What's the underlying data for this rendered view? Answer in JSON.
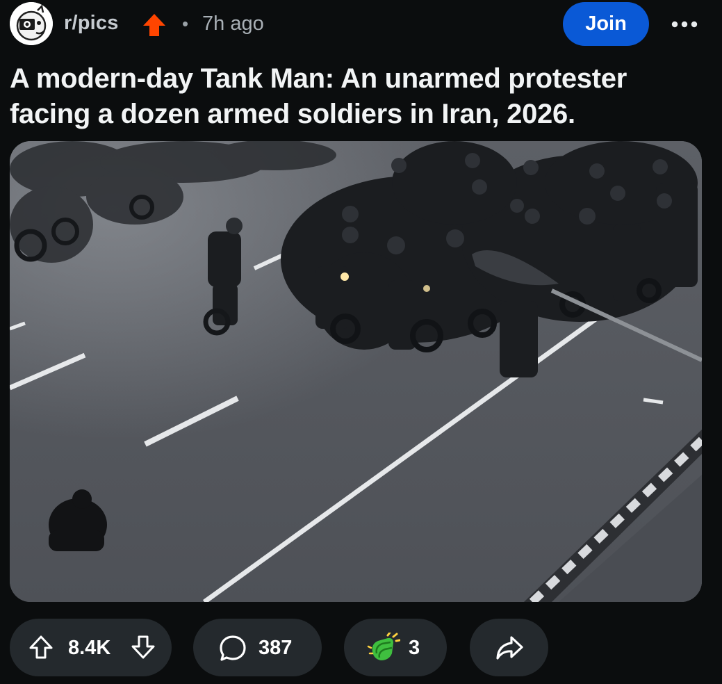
{
  "header": {
    "subreddit": "r/pics",
    "separator": "•",
    "time_ago": "7h ago",
    "join_label": "Join",
    "more_icon": "ellipsis-icon",
    "avatar_icon": "subreddit-avatar-icon",
    "trending_icon": "orange-upvote-arrow-icon"
  },
  "post": {
    "title": "A modern-day Tank Man: An unarmed protester facing a dozen armed soldiers in Iran, 2026.",
    "image_icon": "post-photo-image"
  },
  "actions": {
    "upvotes": "8.4K",
    "comments": "387",
    "awards": "3",
    "upvote_icon": "upvote-arrow-icon",
    "downvote_icon": "downvote-arrow-icon",
    "comment_icon": "comment-bubble-icon",
    "award_icon": "award-clapping-hands-icon",
    "share_icon": "share-arrow-icon"
  },
  "colors": {
    "background": "#0b0d0e",
    "join_button": "#0a59d6",
    "pill_background": "#24292d",
    "trending_arrow": "#ff4500",
    "award_green": "#3fbf3f"
  }
}
